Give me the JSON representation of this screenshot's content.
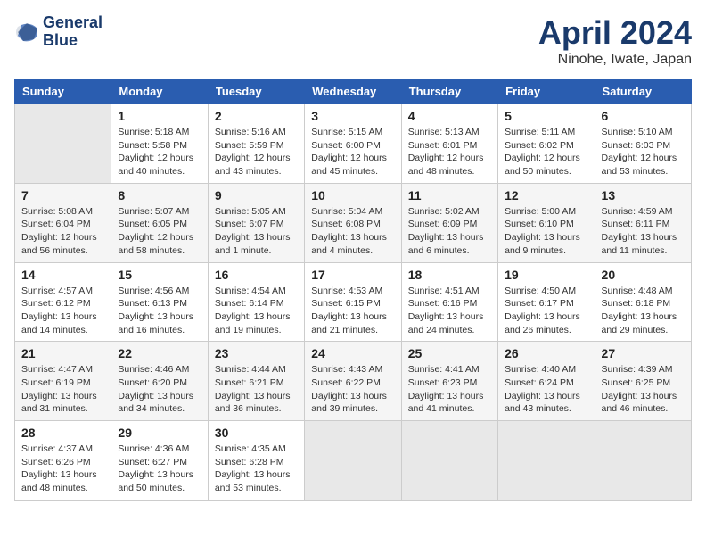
{
  "header": {
    "logo_line1": "General",
    "logo_line2": "Blue",
    "month_title": "April 2024",
    "location": "Ninohe, Iwate, Japan"
  },
  "columns": [
    "Sunday",
    "Monday",
    "Tuesday",
    "Wednesday",
    "Thursday",
    "Friday",
    "Saturday"
  ],
  "weeks": [
    [
      {
        "day": "",
        "info": ""
      },
      {
        "day": "1",
        "info": "Sunrise: 5:18 AM\nSunset: 5:58 PM\nDaylight: 12 hours\nand 40 minutes."
      },
      {
        "day": "2",
        "info": "Sunrise: 5:16 AM\nSunset: 5:59 PM\nDaylight: 12 hours\nand 43 minutes."
      },
      {
        "day": "3",
        "info": "Sunrise: 5:15 AM\nSunset: 6:00 PM\nDaylight: 12 hours\nand 45 minutes."
      },
      {
        "day": "4",
        "info": "Sunrise: 5:13 AM\nSunset: 6:01 PM\nDaylight: 12 hours\nand 48 minutes."
      },
      {
        "day": "5",
        "info": "Sunrise: 5:11 AM\nSunset: 6:02 PM\nDaylight: 12 hours\nand 50 minutes."
      },
      {
        "day": "6",
        "info": "Sunrise: 5:10 AM\nSunset: 6:03 PM\nDaylight: 12 hours\nand 53 minutes."
      }
    ],
    [
      {
        "day": "7",
        "info": "Sunrise: 5:08 AM\nSunset: 6:04 PM\nDaylight: 12 hours\nand 56 minutes."
      },
      {
        "day": "8",
        "info": "Sunrise: 5:07 AM\nSunset: 6:05 PM\nDaylight: 12 hours\nand 58 minutes."
      },
      {
        "day": "9",
        "info": "Sunrise: 5:05 AM\nSunset: 6:07 PM\nDaylight: 13 hours\nand 1 minute."
      },
      {
        "day": "10",
        "info": "Sunrise: 5:04 AM\nSunset: 6:08 PM\nDaylight: 13 hours\nand 4 minutes."
      },
      {
        "day": "11",
        "info": "Sunrise: 5:02 AM\nSunset: 6:09 PM\nDaylight: 13 hours\nand 6 minutes."
      },
      {
        "day": "12",
        "info": "Sunrise: 5:00 AM\nSunset: 6:10 PM\nDaylight: 13 hours\nand 9 minutes."
      },
      {
        "day": "13",
        "info": "Sunrise: 4:59 AM\nSunset: 6:11 PM\nDaylight: 13 hours\nand 11 minutes."
      }
    ],
    [
      {
        "day": "14",
        "info": "Sunrise: 4:57 AM\nSunset: 6:12 PM\nDaylight: 13 hours\nand 14 minutes."
      },
      {
        "day": "15",
        "info": "Sunrise: 4:56 AM\nSunset: 6:13 PM\nDaylight: 13 hours\nand 16 minutes."
      },
      {
        "day": "16",
        "info": "Sunrise: 4:54 AM\nSunset: 6:14 PM\nDaylight: 13 hours\nand 19 minutes."
      },
      {
        "day": "17",
        "info": "Sunrise: 4:53 AM\nSunset: 6:15 PM\nDaylight: 13 hours\nand 21 minutes."
      },
      {
        "day": "18",
        "info": "Sunrise: 4:51 AM\nSunset: 6:16 PM\nDaylight: 13 hours\nand 24 minutes."
      },
      {
        "day": "19",
        "info": "Sunrise: 4:50 AM\nSunset: 6:17 PM\nDaylight: 13 hours\nand 26 minutes."
      },
      {
        "day": "20",
        "info": "Sunrise: 4:48 AM\nSunset: 6:18 PM\nDaylight: 13 hours\nand 29 minutes."
      }
    ],
    [
      {
        "day": "21",
        "info": "Sunrise: 4:47 AM\nSunset: 6:19 PM\nDaylight: 13 hours\nand 31 minutes."
      },
      {
        "day": "22",
        "info": "Sunrise: 4:46 AM\nSunset: 6:20 PM\nDaylight: 13 hours\nand 34 minutes."
      },
      {
        "day": "23",
        "info": "Sunrise: 4:44 AM\nSunset: 6:21 PM\nDaylight: 13 hours\nand 36 minutes."
      },
      {
        "day": "24",
        "info": "Sunrise: 4:43 AM\nSunset: 6:22 PM\nDaylight: 13 hours\nand 39 minutes."
      },
      {
        "day": "25",
        "info": "Sunrise: 4:41 AM\nSunset: 6:23 PM\nDaylight: 13 hours\nand 41 minutes."
      },
      {
        "day": "26",
        "info": "Sunrise: 4:40 AM\nSunset: 6:24 PM\nDaylight: 13 hours\nand 43 minutes."
      },
      {
        "day": "27",
        "info": "Sunrise: 4:39 AM\nSunset: 6:25 PM\nDaylight: 13 hours\nand 46 minutes."
      }
    ],
    [
      {
        "day": "28",
        "info": "Sunrise: 4:37 AM\nSunset: 6:26 PM\nDaylight: 13 hours\nand 48 minutes."
      },
      {
        "day": "29",
        "info": "Sunrise: 4:36 AM\nSunset: 6:27 PM\nDaylight: 13 hours\nand 50 minutes."
      },
      {
        "day": "30",
        "info": "Sunrise: 4:35 AM\nSunset: 6:28 PM\nDaylight: 13 hours\nand 53 minutes."
      },
      {
        "day": "",
        "info": ""
      },
      {
        "day": "",
        "info": ""
      },
      {
        "day": "",
        "info": ""
      },
      {
        "day": "",
        "info": ""
      }
    ]
  ]
}
